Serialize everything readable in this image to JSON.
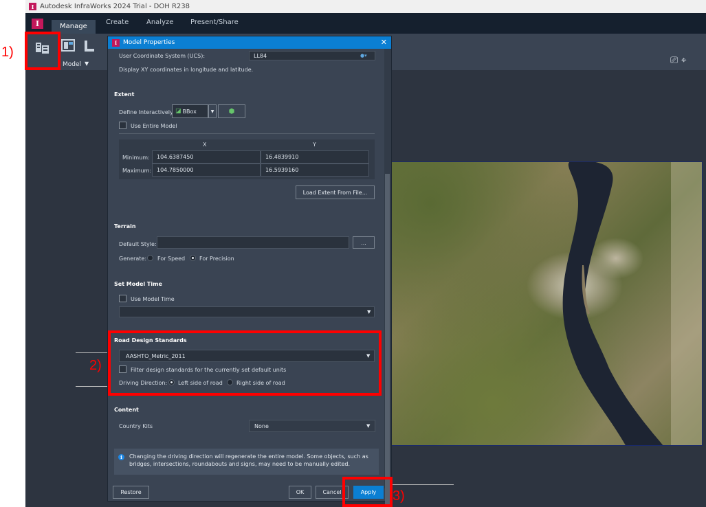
{
  "window": {
    "title": "Autodesk InfraWorks 2024 Trial - DOH R238"
  },
  "ribbon": {
    "tabs": [
      "Manage",
      "Create",
      "Analyze",
      "Present/Share"
    ],
    "model_label": "Model"
  },
  "annotations": {
    "step1": "1)",
    "step2": "2)",
    "step3": "3)"
  },
  "dialog": {
    "title": "Model Properties",
    "ucs": {
      "label": "User Coordinate System (UCS):",
      "value": "LL84",
      "description": "Display XY coordinates in longitude and latitude."
    },
    "extent": {
      "header": "Extent",
      "define_label": "Define Interactively:",
      "define_value": "BBox",
      "use_entire_model": "Use Entire Model",
      "col_x": "X",
      "col_y": "Y",
      "minimum_label": "Minimum:",
      "maximum_label": "Maximum:",
      "min_x": "104.6387450",
      "min_y": "16.4839910",
      "max_x": "104.7850000",
      "max_y": "16.5939160",
      "load_button": "Load Extent From File..."
    },
    "terrain": {
      "header": "Terrain",
      "default_style_label": "Default Style:",
      "browse_button": "...",
      "generate_label": "Generate:",
      "for_speed": "For Speed",
      "for_precision": "For Precision"
    },
    "model_time": {
      "header": "Set Model Time",
      "use_model_time": "Use Model Time"
    },
    "road_design": {
      "header": "Road Design Standards",
      "standard_value": "AASHTO_Metric_2011",
      "filter_label": "Filter design standards for the currently set default units",
      "driving_direction_label": "Driving Direction:",
      "left_side": "Left side of road",
      "right_side": "Right side of road"
    },
    "content": {
      "header": "Content",
      "country_kits_label": "Country Kits",
      "country_kits_value": "None"
    },
    "info": "Changing the driving direction will regenerate the entire model. Some objects, such as bridges, intersections, roundabouts and signs, may need to be manually edited.",
    "buttons": {
      "restore": "Restore",
      "ok": "OK",
      "cancel": "Cancel",
      "apply": "Apply"
    }
  }
}
